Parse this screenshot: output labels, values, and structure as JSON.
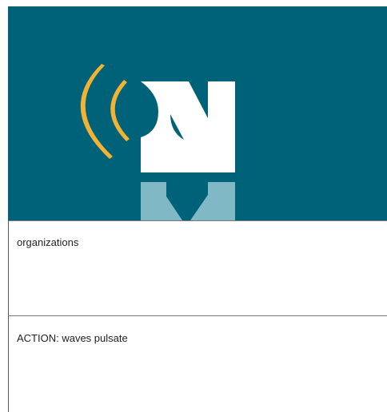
{
  "frame": {
    "description_text": "organizations",
    "action_text": "ACTION: waves pulsate"
  },
  "logo": {
    "background_color": "#006279",
    "wave_color": "#F2B233",
    "letter_color": "#FFFFFF",
    "reflection_color": "#80B8C6",
    "icon": "broadcast-n-logo"
  }
}
